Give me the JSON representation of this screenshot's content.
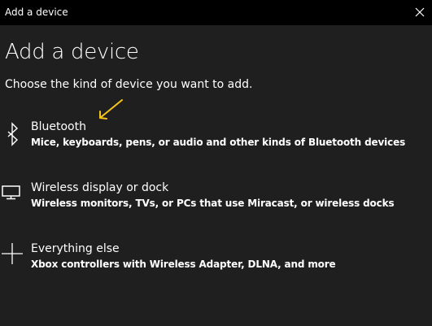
{
  "window": {
    "title": "Add a device",
    "close_glyph": "×"
  },
  "page": {
    "title": "Add a device",
    "subtitle": "Choose the kind of device you want to add."
  },
  "options": [
    {
      "label": "Bluetooth",
      "description": "Mice, keyboards, pens, or audio and other kinds of Bluetooth devices",
      "icon": "bluetooth-icon"
    },
    {
      "label": "Wireless display or dock",
      "description": "Wireless monitors, TVs, or PCs that use Miracast, or wireless docks",
      "icon": "monitor-icon"
    },
    {
      "label": "Everything else",
      "description": "Xbox controllers with Wireless Adapter, DLNA, and more",
      "icon": "plus-icon"
    }
  ],
  "annotation": {
    "icon": "arrow-icon",
    "color": "#f5c518"
  },
  "colors": {
    "background": "#1f1f1f",
    "titlebar": "#000000",
    "text": "#ffffff"
  }
}
